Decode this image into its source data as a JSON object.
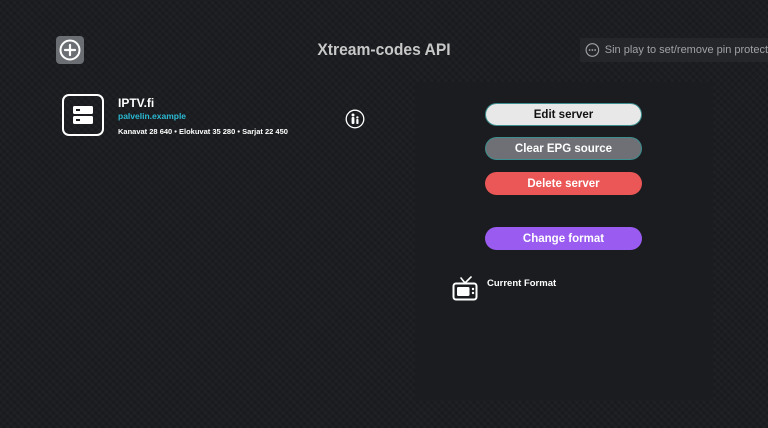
{
  "header": {
    "title": "Xtream-codes API",
    "add_icon": "plus-circle-icon",
    "pin_hint": {
      "icon": "ellipsis-circle-icon",
      "text": "Sin play to set/remove pin protect"
    }
  },
  "servers": [
    {
      "name": "IPTV.fi",
      "host": "palvelin.example",
      "stats": "Kanavat 28 640 • Elokuvat 35 280 • Sarjat 22 450",
      "icon": "server-icon",
      "badge_icon": "family-icon"
    }
  ],
  "panel": {
    "edit_label": "Edit server",
    "epg_label": "Clear EPG source",
    "delete_label": "Delete server",
    "format_label": "Change format",
    "current_format_label": "Current Format",
    "format_icon": "tv-icon"
  },
  "colors": {
    "background": "#1b1d20",
    "accent_teal": "#2bbad4",
    "delete_red": "#eb5757",
    "format_purple": "#9a5cf0",
    "epg_gray": "#6e7075",
    "edit_light": "#e8e8e8"
  }
}
